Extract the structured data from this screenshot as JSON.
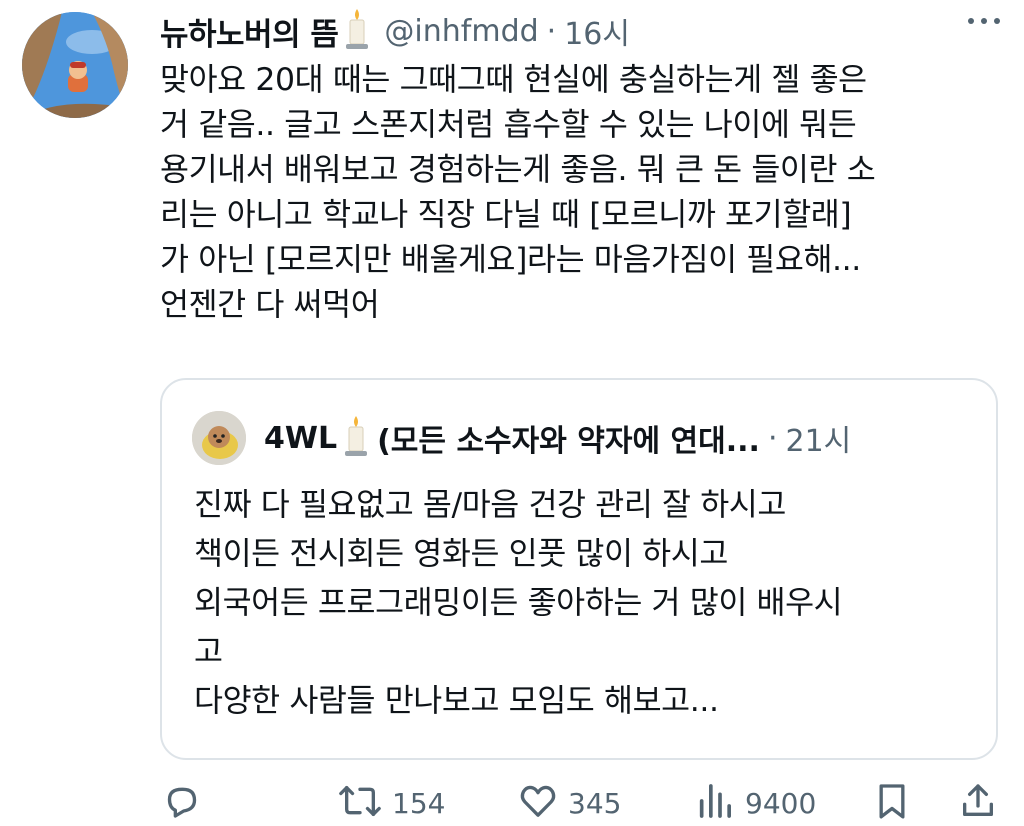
{
  "tweet": {
    "author_name": "뉴하노버의 뜸",
    "handle": "@inhfmdd",
    "separator": "·",
    "time": "16시",
    "lines": [
      "맞아요 20대 때는 그때그때 현실에 충실하는게 젤 좋은",
      "거 같음.. 글고 스폰지처럼 흡수할 수 있는 나이에 뭐든",
      "용기내서 배워보고 경험하는게 좋음. 뭐 큰 돈 들이란 소",
      "리는 아니고 학교나 직장 다닐 때 [모르니까 포기할래]",
      "가 아닌 [모르지만 배울게요]라는 마음가짐이 필요해...",
      "언젠간 다 써먹어"
    ]
  },
  "quote": {
    "author_name": "4WL",
    "description": "(모든 소수자와 약자에 연대...",
    "separator": "·",
    "time": "21시",
    "lines": [
      "진짜 다 필요없고 몸/마음 건강 관리 잘 하시고",
      "책이든 전시회든 영화든 인풋 많이 하시고",
      "외국어든 프로그래밍이든 좋아하는 거 많이 배우시",
      "고",
      "다양한 사람들 만나보고 모임도 해보고..."
    ]
  },
  "actions": {
    "retweets": "154",
    "likes": "345",
    "views": "9400"
  },
  "icons": {
    "reply": "reply-icon",
    "retweet": "retweet-icon",
    "like": "heart-icon",
    "views": "views-icon",
    "bookmark": "bookmark-icon",
    "share": "share-icon",
    "more": "more-icon",
    "candle": "candle-emoji"
  },
  "colors": {
    "text": "#0f1419",
    "secondary": "#536471",
    "border": "#dde3e8"
  }
}
